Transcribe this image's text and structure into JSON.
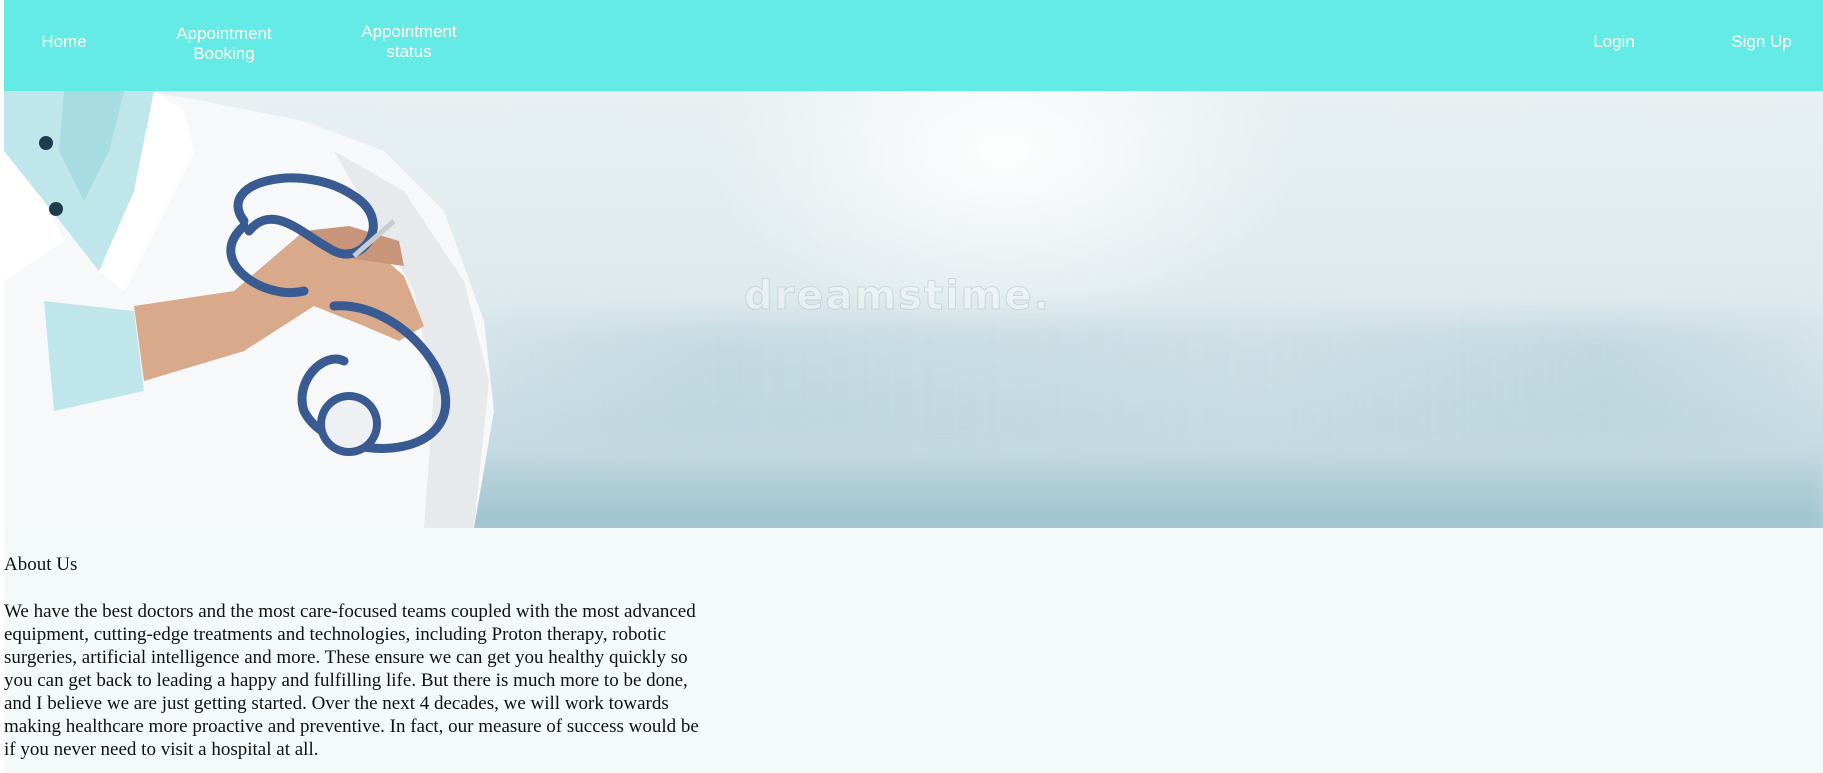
{
  "nav": {
    "home": "Home",
    "appointment_booking": "Appointment Booking",
    "appointment_status": "Appointment status",
    "login": "Login",
    "signup": "Sign Up"
  },
  "hero": {
    "watermark": "dreamstime."
  },
  "about": {
    "title": "About Us",
    "text": "We have the best doctors and the most care-focused teams coupled with the most advanced equipment, cutting-edge treatments and technologies, including Proton therapy, robotic surgeries, artificial intelligence and more. These ensure we can get you healthy quickly so you can get back to leading a happy and fulfilling life. But there is much more to be done, and I believe we are just getting started. Over the next 4 decades, we will work towards making healthcare more proactive and preventive. In fact, our measure of success would be if you never need to visit a hospital at all."
  },
  "colors": {
    "navbar": "#64ebe6",
    "page_background": "#f4f9f9",
    "nav_text": "#ffffff"
  }
}
